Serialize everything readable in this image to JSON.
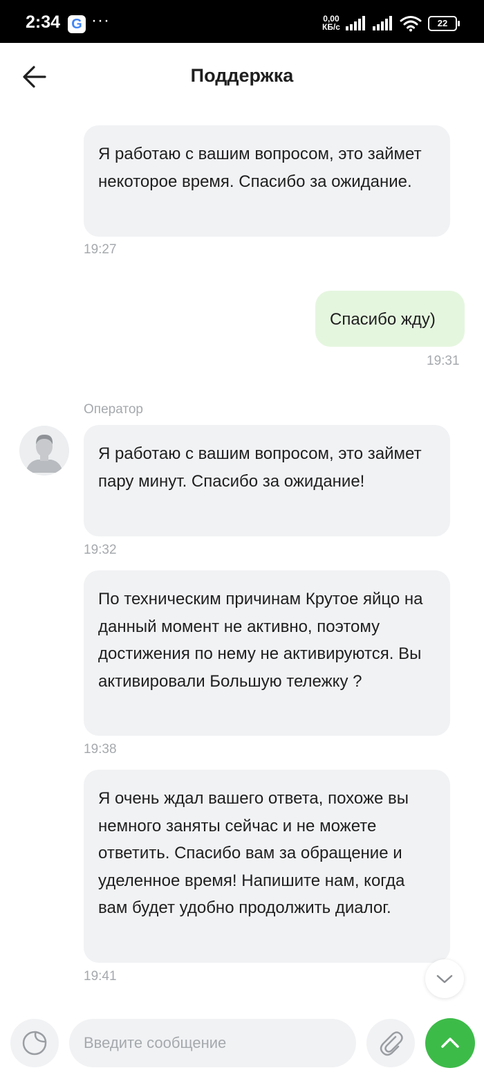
{
  "status_bar": {
    "time": "2:34",
    "google_letter": "G",
    "more": "···",
    "speed_value": "0,00",
    "speed_unit": "КБ/с",
    "battery": "22"
  },
  "header": {
    "title": "Поддержка"
  },
  "messages": [
    {
      "text": "Я работаю с вашим вопросом, это займет некоторое время. Спасибо за ожидание.",
      "time": "19:27",
      "author": "operator"
    },
    {
      "text": "Спасибо жду)",
      "time": "19:31",
      "author": "user"
    },
    {
      "sender": "Оператор",
      "text": "Я работаю с вашим вопросом, это займет пару минут. Спасибо за ожидание!",
      "time": "19:32",
      "author": "operator"
    },
    {
      "text": "По техническим причинам Крутое яйцо на данный момент не активно, поэтому достижения по нему не активируются. Вы активировали Большую тележку ?",
      "time": "19:38",
      "author": "operator"
    },
    {
      "text": "Я очень ждал вашего ответа, похоже вы немного заняты сейчас и не можете ответить. Спасибо вам за обращение и уделенное время! Напишите нам, когда вам будет удобно продолжить диалог.",
      "time": "19:41",
      "author": "operator"
    }
  ],
  "composer": {
    "placeholder": "Введите сообщение"
  },
  "colors": {
    "operator_bubble": "#f1f2f4",
    "user_bubble": "#e5f6df",
    "send_button": "#3dbb49",
    "timestamp": "#a5a9ad"
  },
  "icons": [
    "back-arrow-icon",
    "sticker-icon",
    "paperclip-icon",
    "chevron-up-icon",
    "chevron-down-icon",
    "avatar-icon"
  ]
}
